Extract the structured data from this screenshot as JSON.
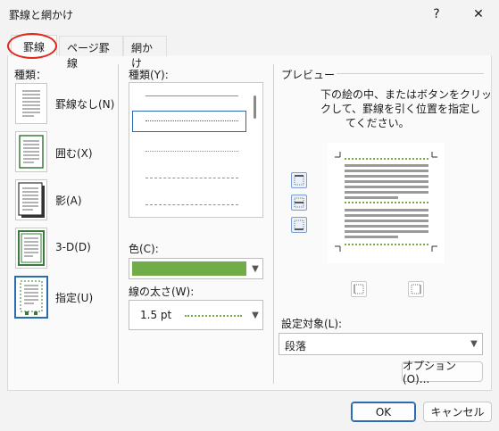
{
  "window": {
    "title": "罫線と網かけ",
    "help_label": "?",
    "close_label": "✕"
  },
  "tabs": [
    {
      "label": "罫線"
    },
    {
      "label": "ページ罫線"
    },
    {
      "label": "網かけ"
    }
  ],
  "settings": {
    "heading": "種類：",
    "items": [
      {
        "label": "罫線なし(N)"
      },
      {
        "label": "囲む(X)"
      },
      {
        "label": "影(A)"
      },
      {
        "label": "3-D(D)"
      },
      {
        "label": "指定(U)"
      }
    ]
  },
  "style": {
    "heading": "種類(Y):",
    "color_label": "色(C):",
    "color_value": "#70ad47",
    "width_label": "線の太さ(W):",
    "width_value": "1.5 pt"
  },
  "preview": {
    "heading": "プレビュー",
    "instructions": [
      "下の絵の中、またはボタンをクリッ",
      "クして、罫線を引く位置を指定し",
      "てください。"
    ]
  },
  "apply_to": {
    "label": "設定対象(L):",
    "value": "段落"
  },
  "buttons": {
    "options": "オプション(O)...",
    "ok": "OK",
    "cancel": "キャンセル"
  }
}
